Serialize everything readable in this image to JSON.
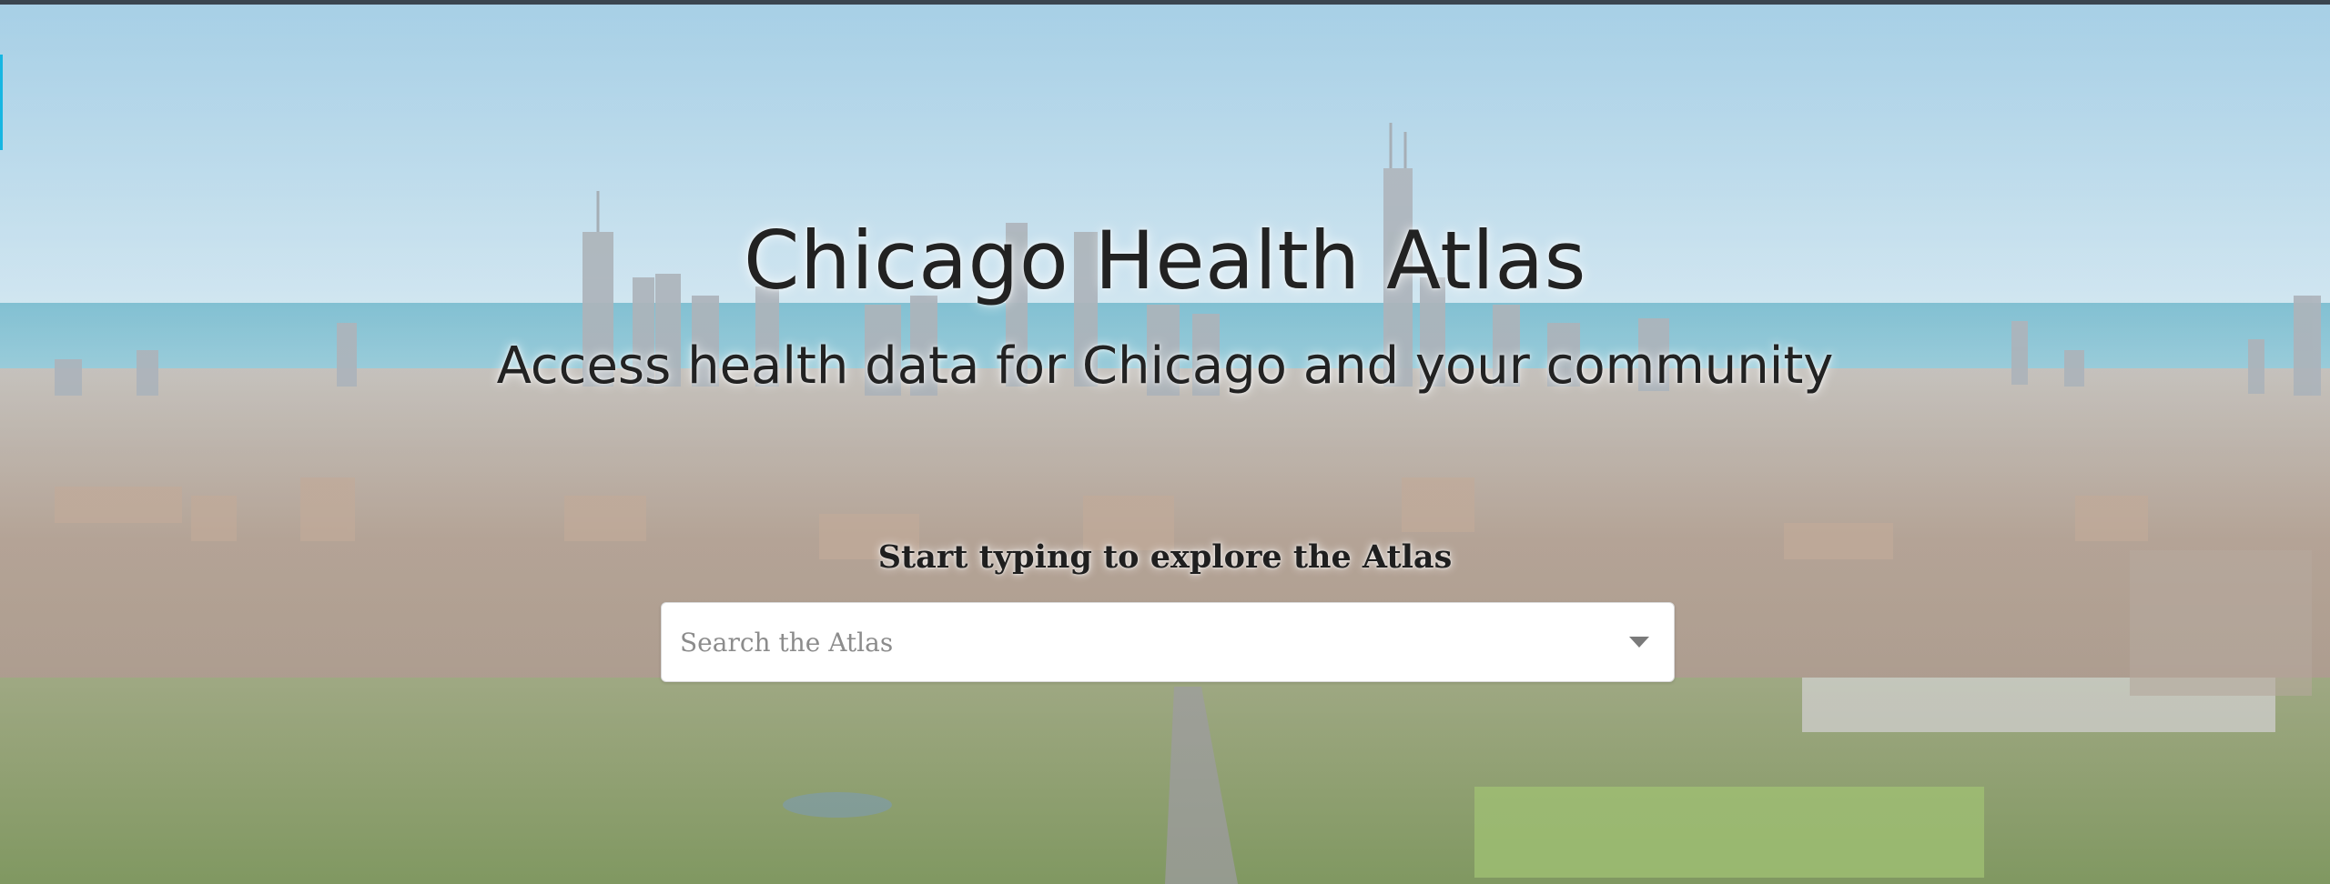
{
  "hero": {
    "title": "Chicago Health Atlas",
    "subtitle": "Access health data for Chicago and your community",
    "background": "chicago-skyline-aerial-photo"
  },
  "search": {
    "prompt": "Start typing to explore the Atlas",
    "placeholder": "Search the Atlas",
    "value": "",
    "toggle_icon": "chevron-down-icon"
  },
  "colors": {
    "top_bar": "#3a4550",
    "side_accent": "#17b6e2",
    "title_text": "#222222",
    "search_background": "#ffffff",
    "placeholder_text": "#8c8c8c"
  }
}
